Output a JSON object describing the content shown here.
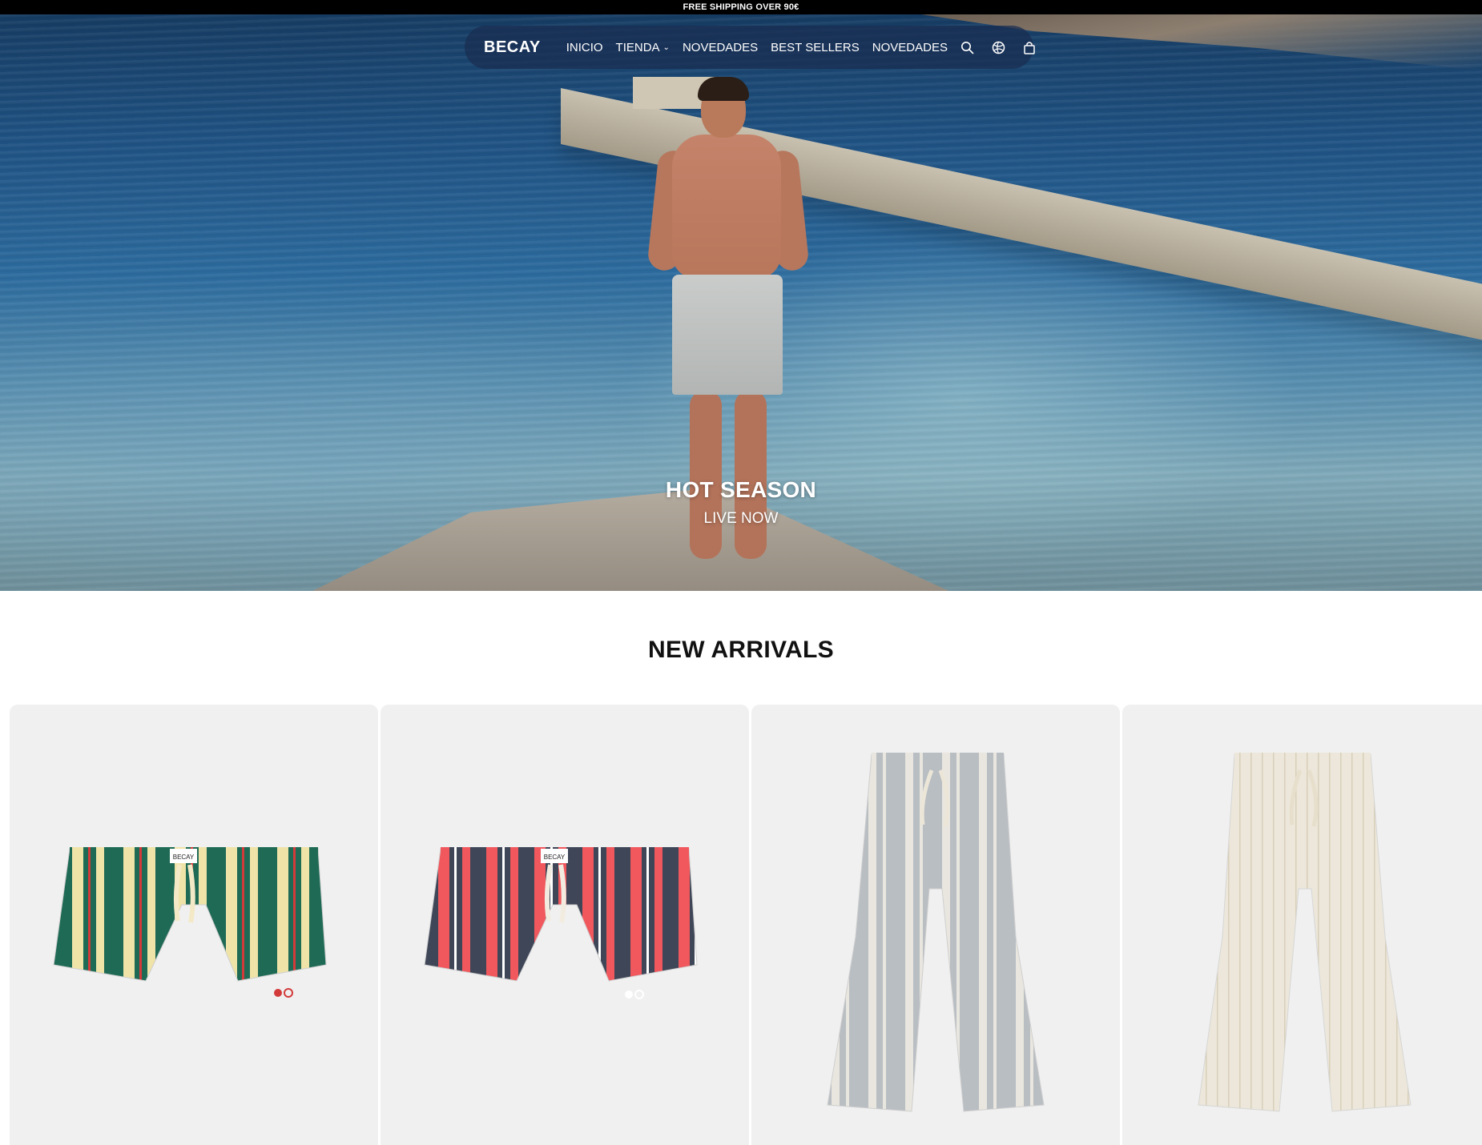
{
  "announcement": {
    "text": "FREE SHIPPING OVER 90€"
  },
  "nav": {
    "brand": "BECAY",
    "items": [
      {
        "label": "INICIO"
      },
      {
        "label": "TIENDA"
      },
      {
        "label": "NOVEDADES"
      },
      {
        "label": "BEST SELLERS"
      },
      {
        "label": "NOVEDADES"
      }
    ],
    "icons": [
      "search-icon",
      "globe-icon",
      "bag-icon"
    ]
  },
  "hero": {
    "title": "HOT SEASON",
    "subtitle": "LIVE NOW"
  },
  "new_arrivals": {
    "title": "NEW ARRIVALS",
    "products": [
      {
        "kind": "swim-shorts",
        "colors": [
          "#1f6a55",
          "#efe3a8",
          "#d33a3a"
        ],
        "brand_label": "BECAY"
      },
      {
        "kind": "swim-shorts",
        "colors": [
          "#3e4657",
          "#f0585d",
          "#ffffff"
        ],
        "brand_label": "BECAY"
      },
      {
        "kind": "trousers",
        "colors": [
          "#b9bec3",
          "#e8e6de"
        ]
      },
      {
        "kind": "trousers",
        "colors": [
          "#ece7da",
          "#d8cfb9"
        ]
      }
    ]
  }
}
